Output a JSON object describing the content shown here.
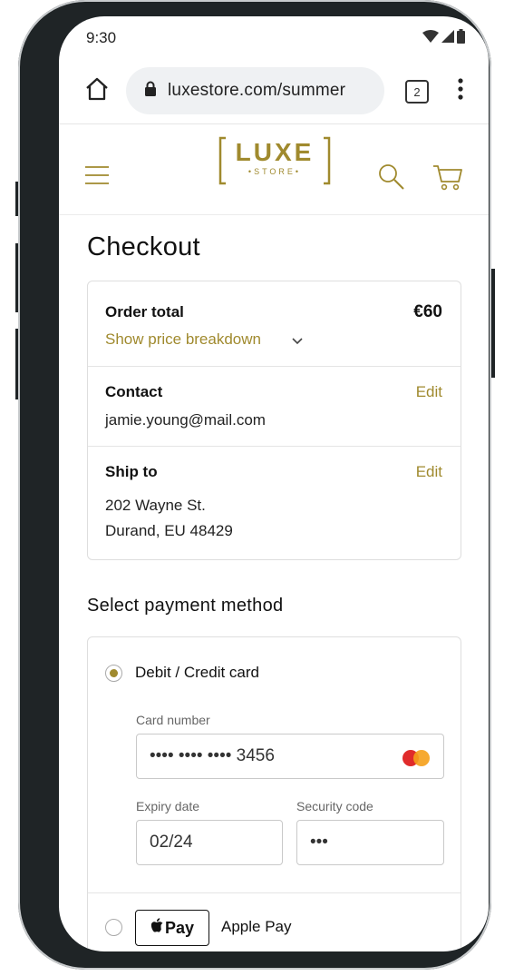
{
  "status_bar": {
    "time": "9:30",
    "icons": [
      "wifi-icon",
      "signal-icon",
      "battery-icon"
    ]
  },
  "browser": {
    "url": "luxestore.com/summer",
    "tab_count": "2",
    "icons": [
      "home-icon",
      "lock-icon",
      "more-vert-icon"
    ]
  },
  "site": {
    "logo_word": "LUXE",
    "logo_sub": "•STORE•",
    "brand_color": "#a08a2e",
    "icons": [
      "menu-icon",
      "search-icon",
      "cart-icon"
    ]
  },
  "checkout": {
    "title": "Checkout",
    "order_total_label": "Order total",
    "order_total_value": "€60",
    "price_breakdown_link": "Show price breakdown",
    "contact_label": "Contact",
    "contact_edit": "Edit",
    "contact_email": "jamie.young@mail.com",
    "ship_label": "Ship to",
    "ship_edit": "Edit",
    "ship_line1": "202 Wayne St.",
    "ship_line2": "Durand, EU 48429"
  },
  "payment": {
    "title": "Select payment method",
    "card_option": "Debit / Credit card",
    "card_number_label": "Card number",
    "card_number_value": "•••• •••• •••• 3456",
    "expiry_label": "Expiry date",
    "expiry_value": "02/24",
    "security_label": "Security code",
    "security_value": "•••",
    "applepay_badge": "Pay",
    "applepay_label": "Apple Pay"
  }
}
